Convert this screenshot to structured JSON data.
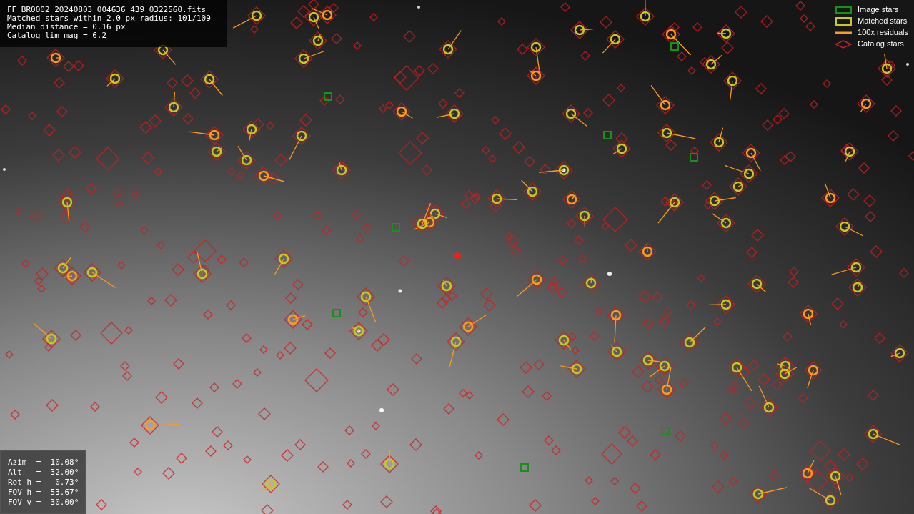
{
  "info_panel": {
    "lines": [
      "FF_BR0002_20240803_004636_439_0322560.fits",
      "Matched stars within 2.0 px radius: 101/109",
      "Median distance = 0.16 px",
      "Catalog lim mag = 6.2"
    ]
  },
  "legend": [
    {
      "kind": "box",
      "color": "#1a8f1a",
      "label": "Image stars"
    },
    {
      "kind": "box",
      "color": "#c8c81e",
      "label": "Matched stars"
    },
    {
      "kind": "line",
      "color": "#ff9a1a",
      "label": "100x residuals"
    },
    {
      "kind": "diamond",
      "color": "#cc1f1f",
      "label": "Catalog stars"
    }
  ],
  "pointing_panel": {
    "lines": [
      "Azim  =  10.08°",
      "Alt   =  32.00°",
      "Rot h =   0.73°",
      "FOV h =  53.67°",
      "FOV v =  30.00°"
    ]
  }
}
